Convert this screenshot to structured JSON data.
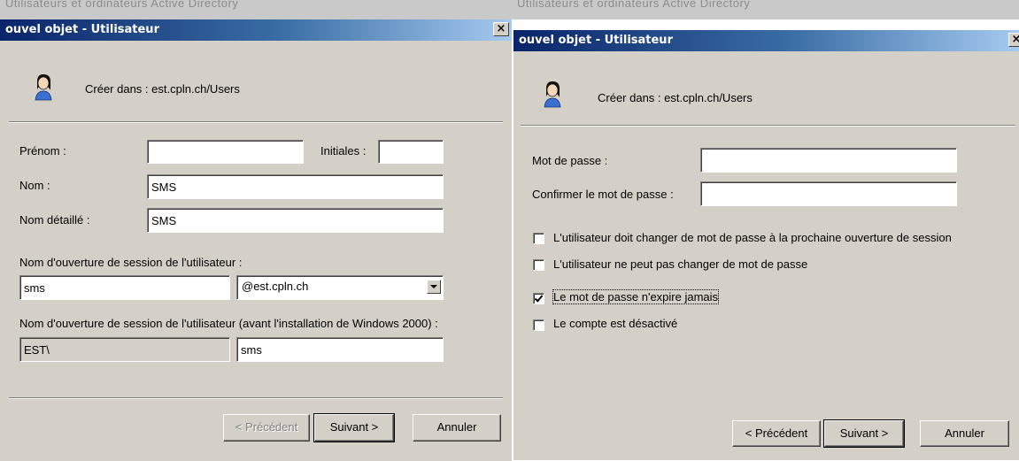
{
  "background_caption": "Utilisateurs et ordinateurs Active Directory",
  "left": {
    "title": "ouvel objet - Utilisateur",
    "close_glyph": "×",
    "icon": "user-icon",
    "create_label": "Créer dans :",
    "create_path": "est.cpln.ch/Users",
    "first_name_label": "Prénom :",
    "first_name_value": "",
    "initials_label": "Initiales :",
    "initials_value": "",
    "last_name_label": "Nom :",
    "last_name_value": "SMS",
    "full_name_label": "Nom détaillé :",
    "full_name_value": "SMS",
    "logon_label": "Nom d'ouverture de session de l'utilisateur :",
    "logon_value": "sms",
    "domain_value": "@est.cpln.ch",
    "prewin_label": "Nom d'ouverture de session de l'utilisateur (avant l'installation de Windows 2000) :",
    "prewin_domain": "EST\\",
    "prewin_value": "sms",
    "buttons": {
      "prev": "< Précédent",
      "next": "Suivant >",
      "cancel": "Annuler"
    }
  },
  "right": {
    "title": "ouvel objet - Utilisateur",
    "close_glyph": "×",
    "icon": "user-icon",
    "create_label": "Créer dans :",
    "create_path": "est.cpln.ch/Users",
    "password_label": "Mot de passe :",
    "password_value": "",
    "confirm_label": "Confirmer le mot de passe :",
    "confirm_value": "",
    "checkboxes": [
      {
        "label": "L'utilisateur doit changer de mot de passe à la prochaine ouverture de session",
        "checked": false
      },
      {
        "label": "L'utilisateur ne peut pas changer de mot de passe",
        "checked": false
      },
      {
        "label": "Le mot de passe n'expire jamais",
        "checked": true
      },
      {
        "label": "Le compte est désactivé",
        "checked": false
      }
    ],
    "buttons": {
      "prev": "< Précédent",
      "next": "Suivant >",
      "cancel": "Annuler"
    }
  }
}
